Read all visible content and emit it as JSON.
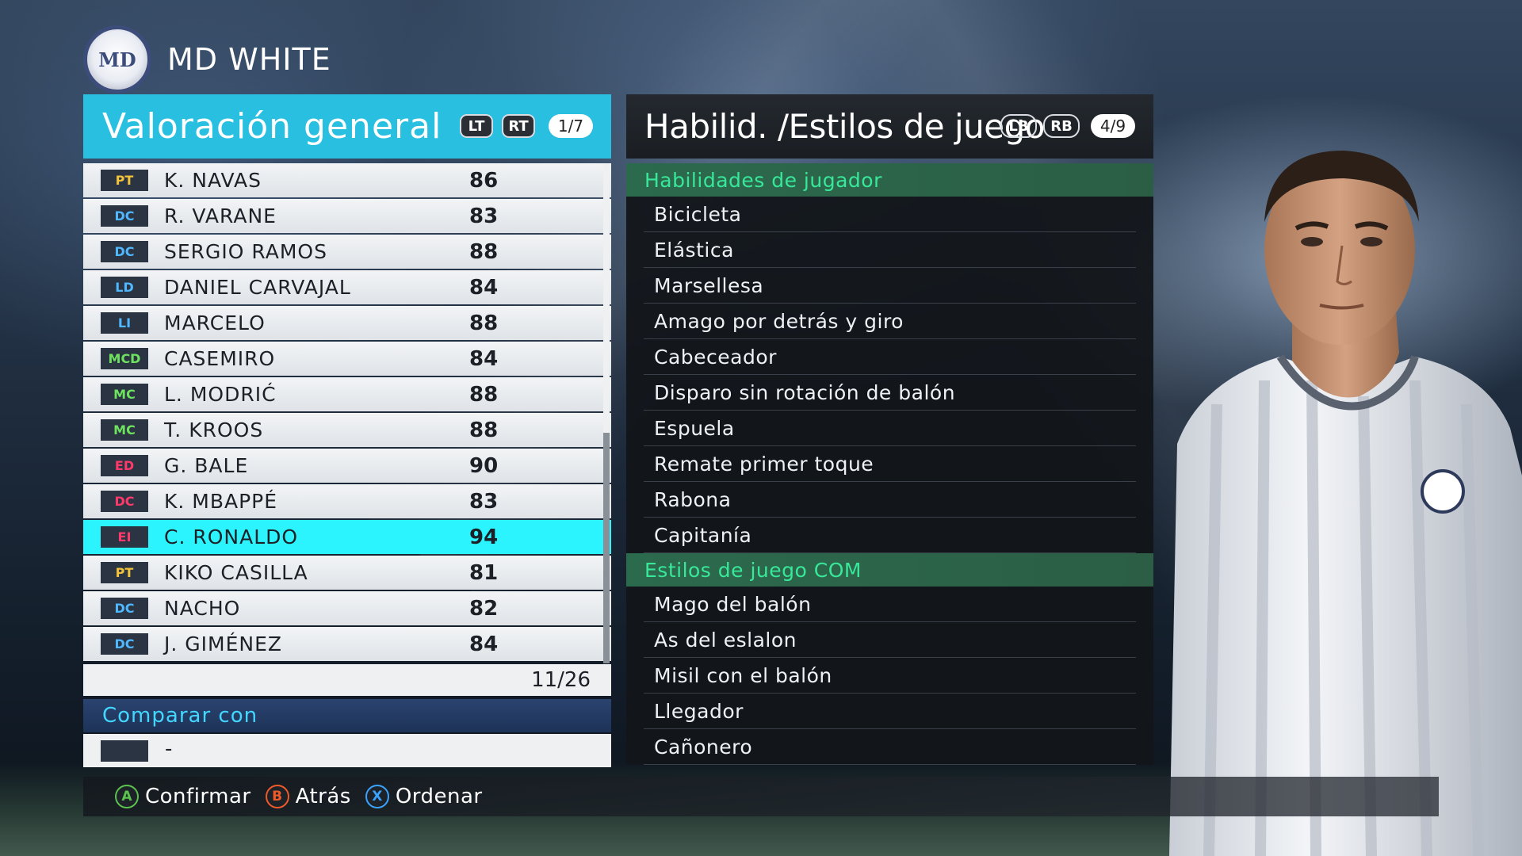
{
  "team": {
    "logo_text": "MD",
    "name": "MD WHITE"
  },
  "left_panel": {
    "title": "Valoración general",
    "btn_lt": "LT",
    "btn_rt": "RT",
    "page": "1/7",
    "players": [
      {
        "pos": "PT",
        "name": "K. NAVAS",
        "rating": "86"
      },
      {
        "pos": "DC",
        "name": "R. VARANE",
        "rating": "83"
      },
      {
        "pos": "DC",
        "name": "SERGIO RAMOS",
        "rating": "88"
      },
      {
        "pos": "LD",
        "name": "DANIEL CARVAJAL",
        "rating": "84"
      },
      {
        "pos": "LI",
        "name": "MARCELO",
        "rating": "88"
      },
      {
        "pos": "MCD",
        "name": "CASEMIRO",
        "rating": "84"
      },
      {
        "pos": "MC",
        "name": "L. MODRIĆ",
        "rating": "88"
      },
      {
        "pos": "MC",
        "name": "T. KROOS",
        "rating": "88"
      },
      {
        "pos": "ED",
        "name": "G. BALE",
        "rating": "90"
      },
      {
        "pos": "DC",
        "name": "K. MBAPPÉ",
        "rating": "83"
      },
      {
        "pos": "EI",
        "name": "C. RONALDO",
        "rating": "94"
      },
      {
        "pos": "PT",
        "name": "KIKO CASILLA",
        "rating": "81"
      },
      {
        "pos": "DC",
        "name": "NACHO",
        "rating": "82"
      },
      {
        "pos": "DC",
        "name": "J. GIMÉNEZ",
        "rating": "84"
      }
    ],
    "count": "11/26",
    "compare_title": "Comparar con",
    "compare_value": "-"
  },
  "right_panel": {
    "title": "Habilid. /Estilos de juego",
    "btn_lb": "LB",
    "btn_rb": "RB",
    "page": "4/9",
    "skills_title": "Habilidades de jugador",
    "skills": [
      "Bicicleta",
      "Elástica",
      "Marsellesa",
      "Amago por detrás y giro",
      "Cabeceador",
      "Disparo sin rotación de balón",
      "Espuela",
      "Remate primer toque",
      "Rabona",
      "Capitanía"
    ],
    "styles_title": "Estilos de juego COM",
    "styles": [
      "Mago del balón",
      "As del eslalon",
      "Misil con el balón",
      "Llegador",
      "Cañonero"
    ]
  },
  "footer": {
    "confirm_key": "A",
    "confirm_label": "Confirmar",
    "back_key": "B",
    "back_label": "Atrás",
    "sort_key": "X",
    "sort_label": "Ordenar"
  }
}
